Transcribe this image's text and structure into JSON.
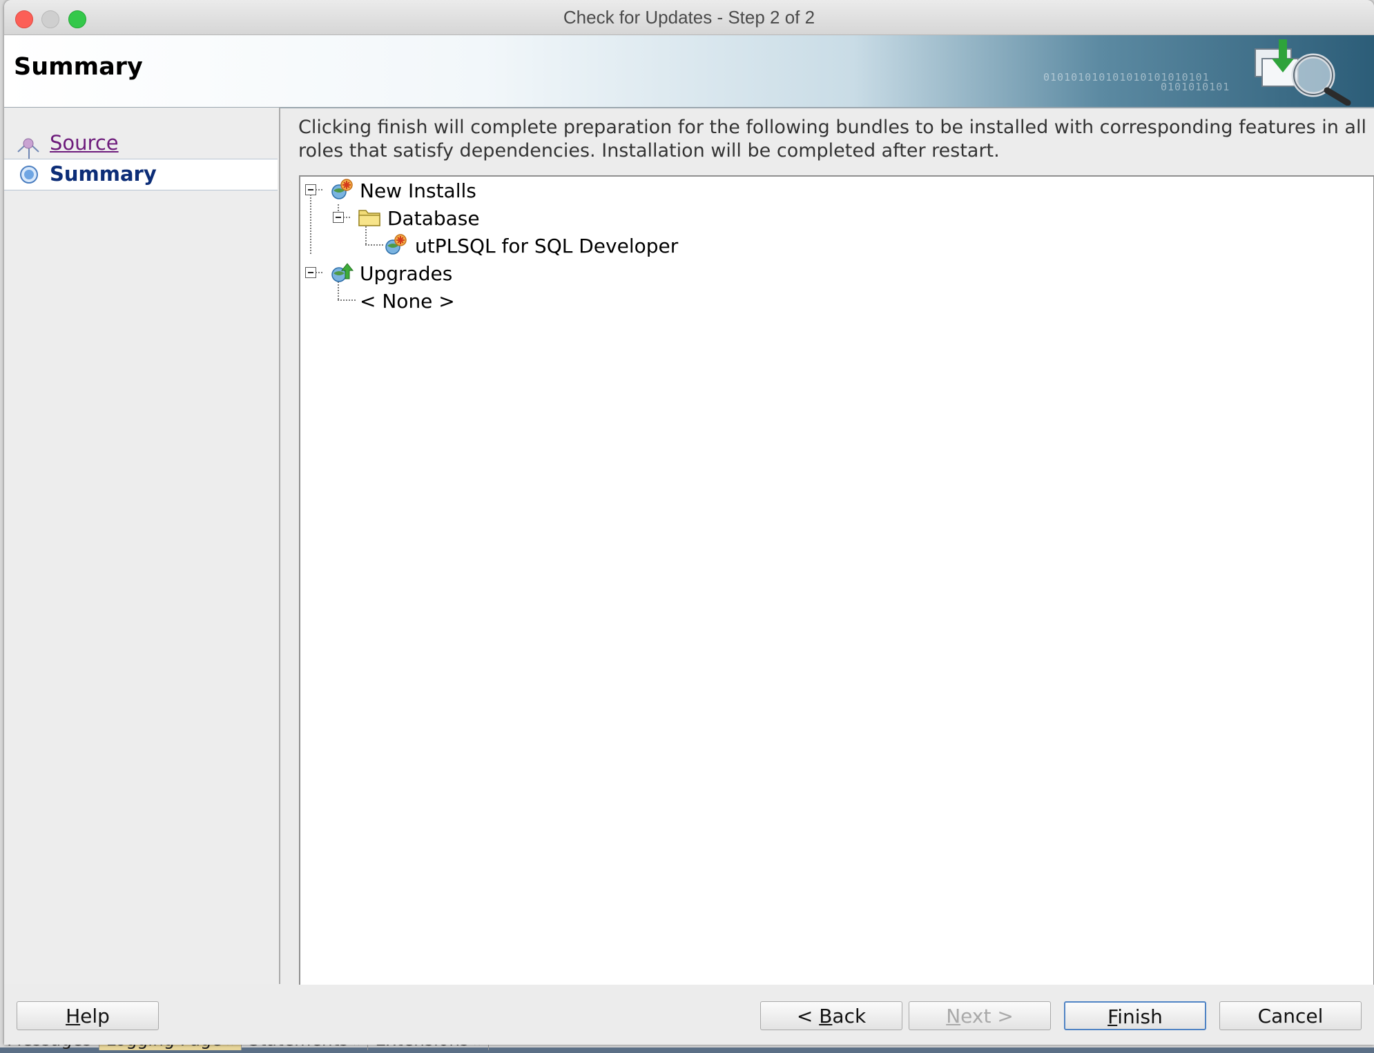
{
  "window": {
    "title": "Check for Updates - Step 2 of 2"
  },
  "banner": {
    "title": "Summary",
    "bits_line1": "010101010101010101010101",
    "bits_line2": "0101010101"
  },
  "nav": {
    "items": [
      {
        "label": "Source",
        "state": "visited"
      },
      {
        "label": "Summary",
        "state": "current"
      }
    ]
  },
  "content": {
    "description": "Clicking finish will complete preparation for the following bundles to be installed with corresponding features in all roles that satisfy dependencies. Installation will be completed after restart.",
    "tree": {
      "new_installs": "New Installs",
      "database": "Database",
      "utplsql": "utPLSQL for SQL Developer",
      "upgrades": "Upgrades",
      "none": "< None >"
    }
  },
  "buttons": {
    "help": {
      "mnemonic": "H",
      "rest": "elp"
    },
    "back": {
      "prefix": "< ",
      "mnemonic": "B",
      "rest": "ack"
    },
    "next": {
      "mnemonic": "N",
      "rest": "ext >"
    },
    "finish": {
      "mnemonic": "F",
      "rest": "inish"
    },
    "cancel": "Cancel"
  },
  "background_tabs": [
    {
      "label": "Messages"
    },
    {
      "label": "Logging Page"
    },
    {
      "label": "Statements"
    },
    {
      "label": "Extensions"
    }
  ],
  "colors": {
    "accent": "#4f83c4",
    "link_visited": "#6d1b7b",
    "current_step": "#0c2d77"
  }
}
